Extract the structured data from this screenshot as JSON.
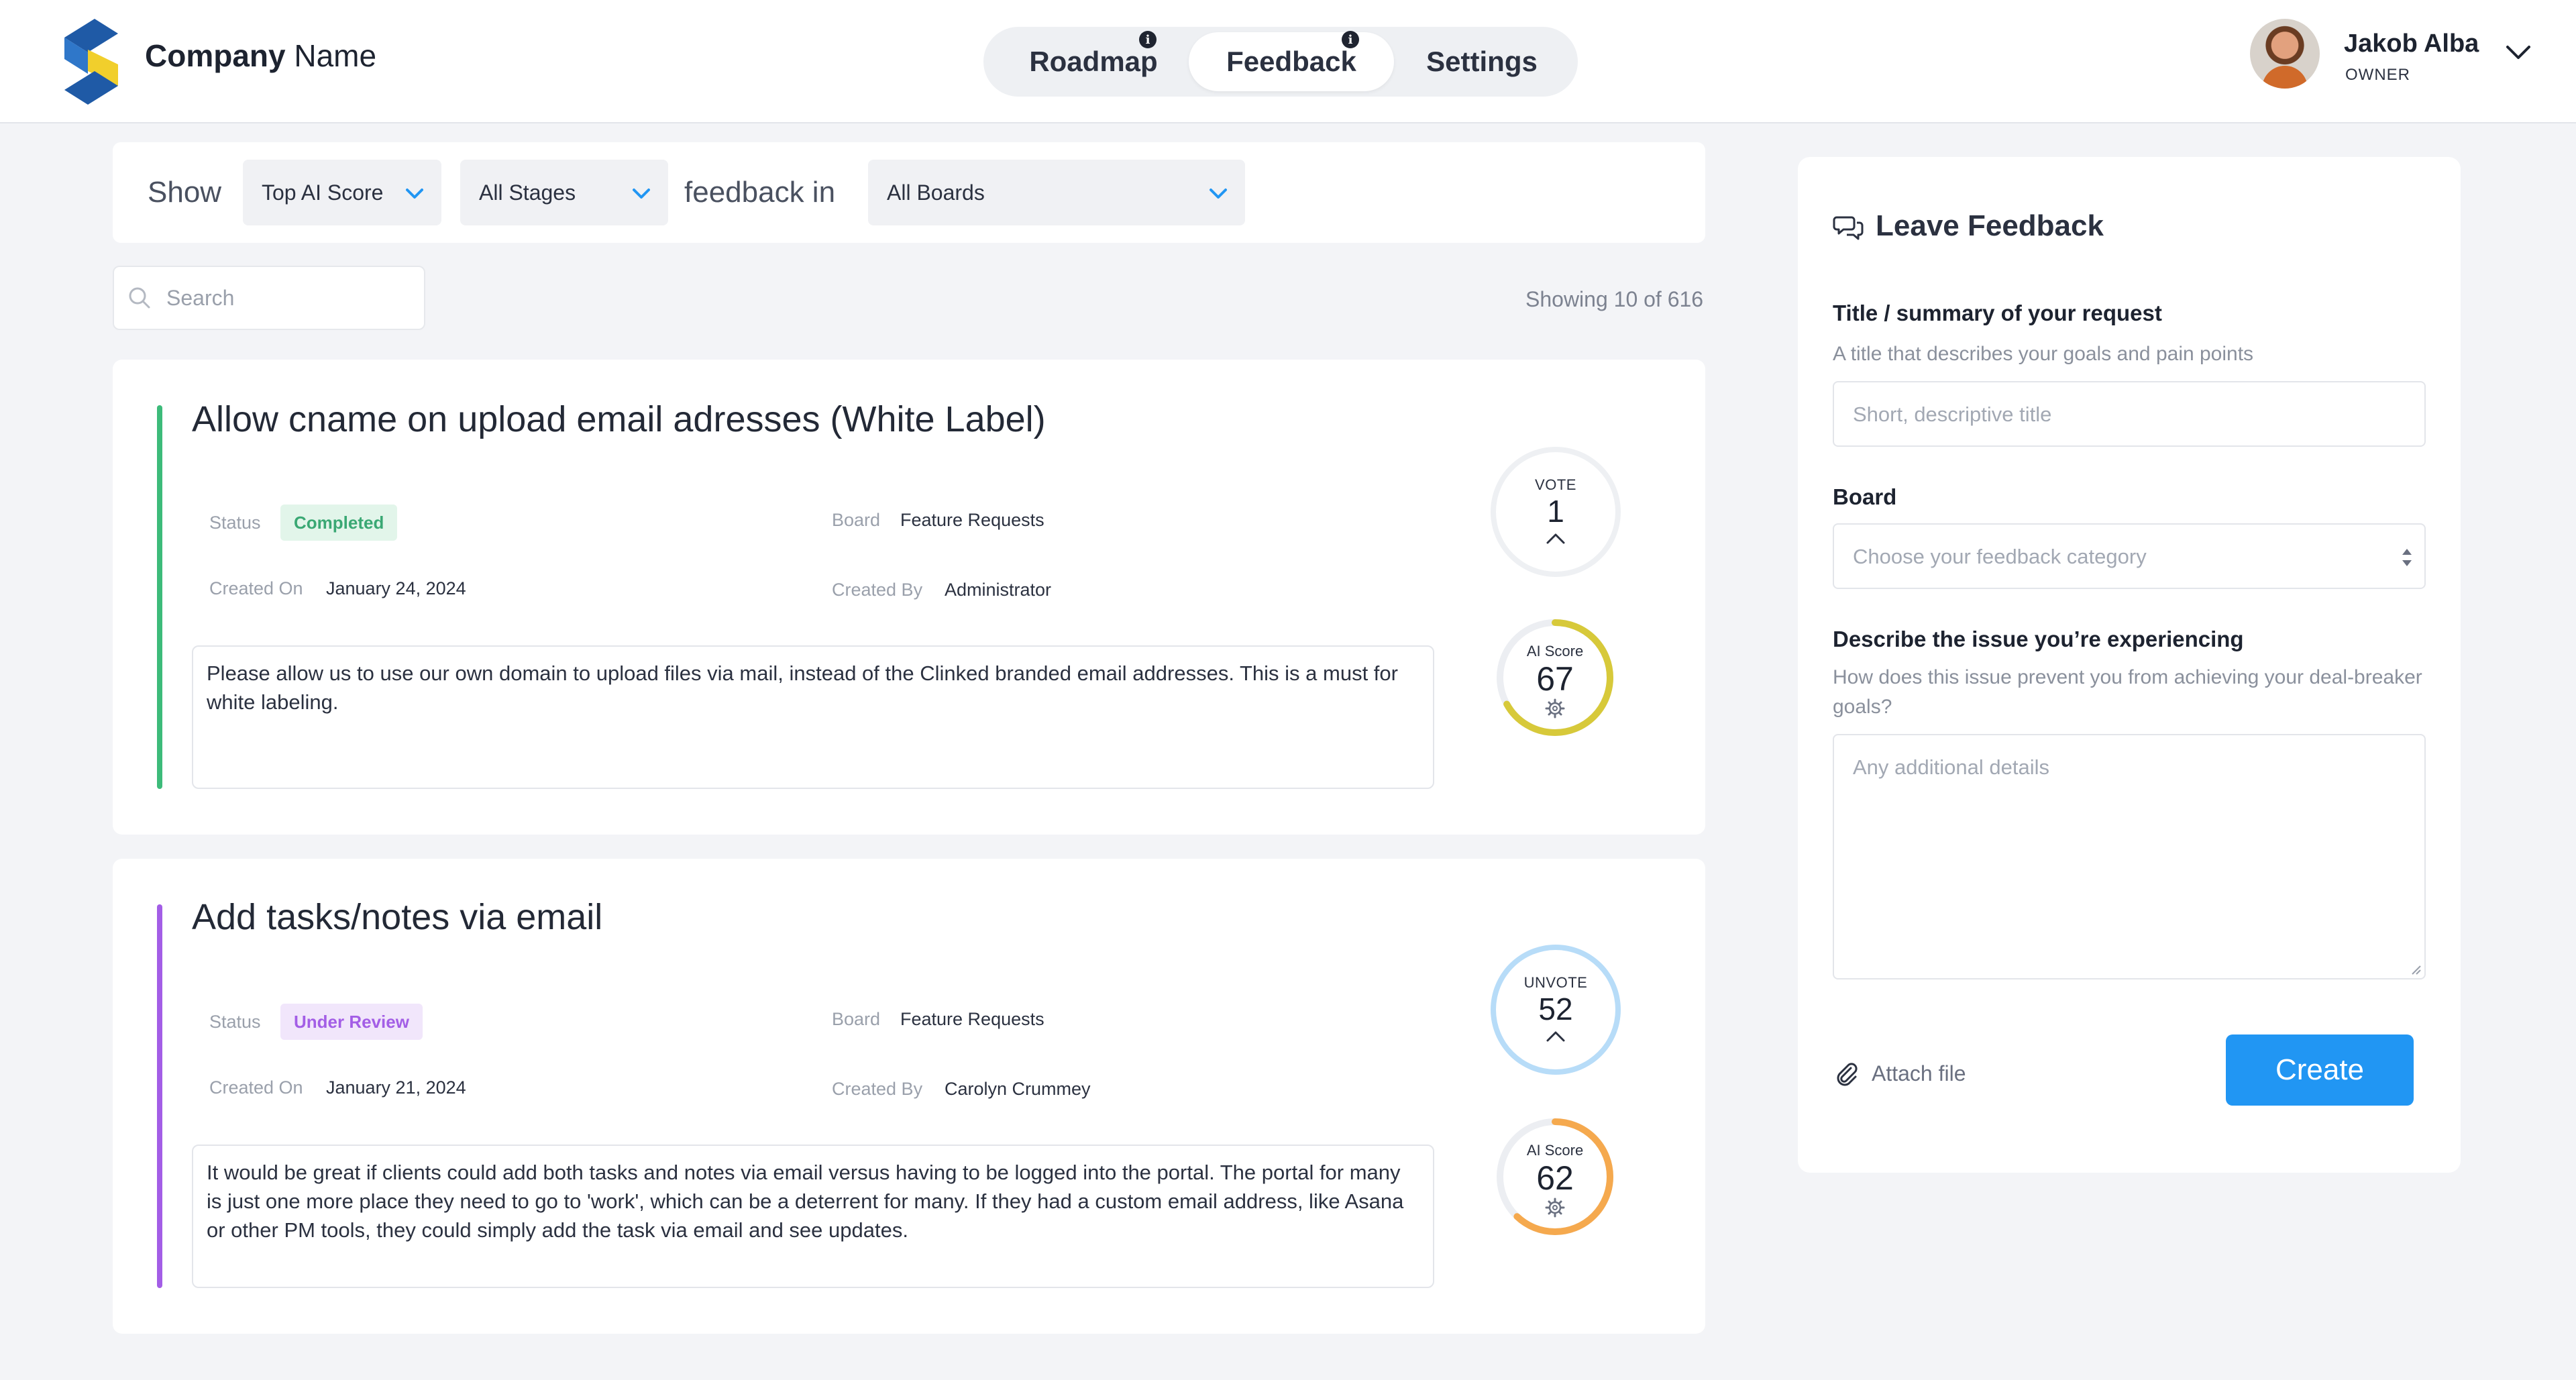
{
  "header": {
    "company_bold": "Company",
    "company_rest": " Name",
    "nav": [
      {
        "label": "Roadmap",
        "active": false
      },
      {
        "label": "Feedback",
        "active": true
      },
      {
        "label": "Settings",
        "active": false
      }
    ],
    "user": {
      "name": "Jakob Alba",
      "role": "OWNER"
    }
  },
  "filters": {
    "show_text": "Show",
    "sort_value": "Top AI Score",
    "stage_value": "All Stages",
    "feedback_in_text": "feedback in",
    "board_value": "All Boards"
  },
  "search": {
    "placeholder": "Search"
  },
  "showing": "Showing 10 of 616",
  "cards": [
    {
      "title": "Allow cname on upload email adresses (White Label)",
      "status_label": "Status",
      "status": "Completed",
      "board_label": "Board",
      "board": "Feature Requests",
      "created_on_label": "Created On",
      "created_on": "January 24, 2024",
      "created_by_label": "Created By",
      "created_by": "Administrator",
      "description": "Please allow us to use our own domain to upload files via mail, instead of the Clinked branded email addresses. This is a must for  white labeling.",
      "vote_label": "VOTE",
      "vote_count": "1",
      "ai_label": "AI Score",
      "ai_score": "67",
      "accent_color": "#3dbb7a",
      "ring_color": "#d7c93a"
    },
    {
      "title": "Add tasks/notes via email",
      "status_label": "Status",
      "status": "Under Review",
      "board_label": "Board",
      "board": "Feature Requests",
      "created_on_label": "Created On",
      "created_on": "January 21, 2024",
      "created_by_label": "Created By",
      "created_by": "Carolyn Crummey",
      "description": "It would be great if clients could add both tasks and notes via email versus having to be logged into the portal. The portal for many is just one more place they need to go to 'work', which can be a deterrent for many. If they had a custom email address, like Asana or other PM tools, they could simply add the task via email and see updates.",
      "vote_label": "UNVOTE",
      "vote_count": "52",
      "ai_label": "AI Score",
      "ai_score": "62",
      "accent_color": "#a35ee6",
      "ring_color": "#f5a94e"
    }
  ],
  "panel": {
    "title": "Leave Feedback",
    "title_label": "Title / summary of your request",
    "title_help": "A title that describes your goals and pain points",
    "title_placeholder": "Short, descriptive title",
    "board_label": "Board",
    "board_placeholder": "Choose your feedback category",
    "issue_label": "Describe the issue you’re experiencing",
    "issue_help": "How does this issue prevent you from achieving your deal-breaker goals?",
    "issue_placeholder": "Any additional details",
    "attach_label": "Attach file",
    "create_label": "Create"
  },
  "colors": {
    "primary": "#2196f3",
    "completed_bg": "#e2f5ea",
    "completed_fg": "#3aa874",
    "review_bg": "#f1e6fb",
    "review_fg": "#a35ee6"
  }
}
